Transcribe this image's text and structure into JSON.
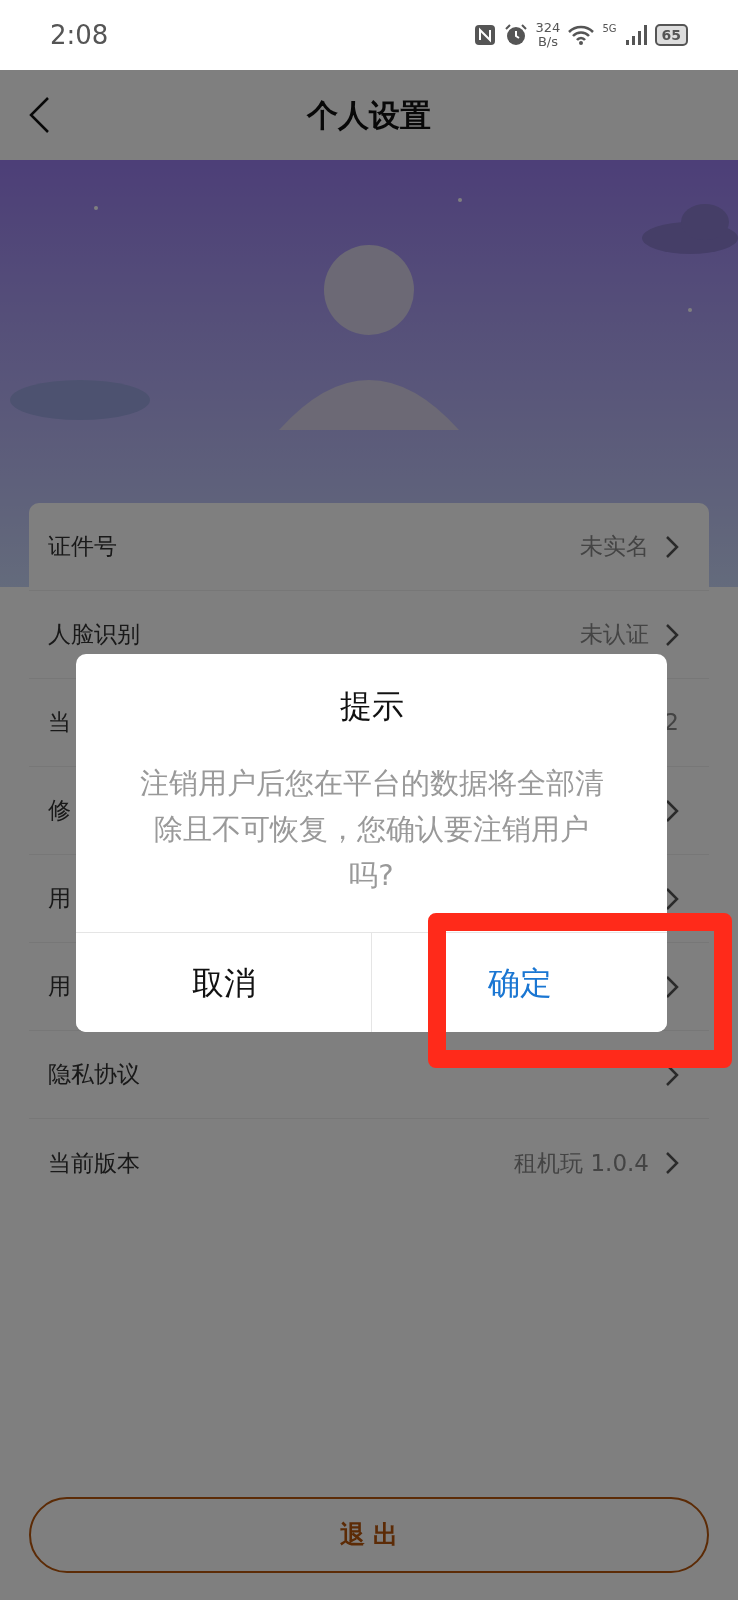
{
  "status_bar": {
    "time": "2:08",
    "speed": [
      "324",
      "B/s"
    ],
    "network": "5G",
    "battery": "65"
  },
  "header": {
    "title": "个人设置"
  },
  "settings": [
    {
      "label": "证件号",
      "value": "未实名",
      "chevron": true
    },
    {
      "label": "人脸识别",
      "value": "未认证",
      "chevron": true
    },
    {
      "label": "当",
      "value": "2",
      "chevron": false
    },
    {
      "label": "修",
      "chevron": true
    },
    {
      "label": "用",
      "chevron": true
    },
    {
      "label": "用",
      "chevron": true
    },
    {
      "label": "隐私协议",
      "chevron": true
    },
    {
      "label": "当前版本",
      "value": "租机玩 1.0.4",
      "chevron": true
    }
  ],
  "logout_button": "退 出",
  "dialog": {
    "title": "提示",
    "message": "注销用户后您在平台的数据将全部清除且不可恢复，您确认要注销用户吗?",
    "buttons": [
      {
        "label": "取消",
        "kind": "cancel"
      },
      {
        "label": "确定",
        "kind": "confirm"
      }
    ]
  },
  "annotations": [
    {
      "kind": "rectangle",
      "color": "#ff2a1a"
    }
  ]
}
